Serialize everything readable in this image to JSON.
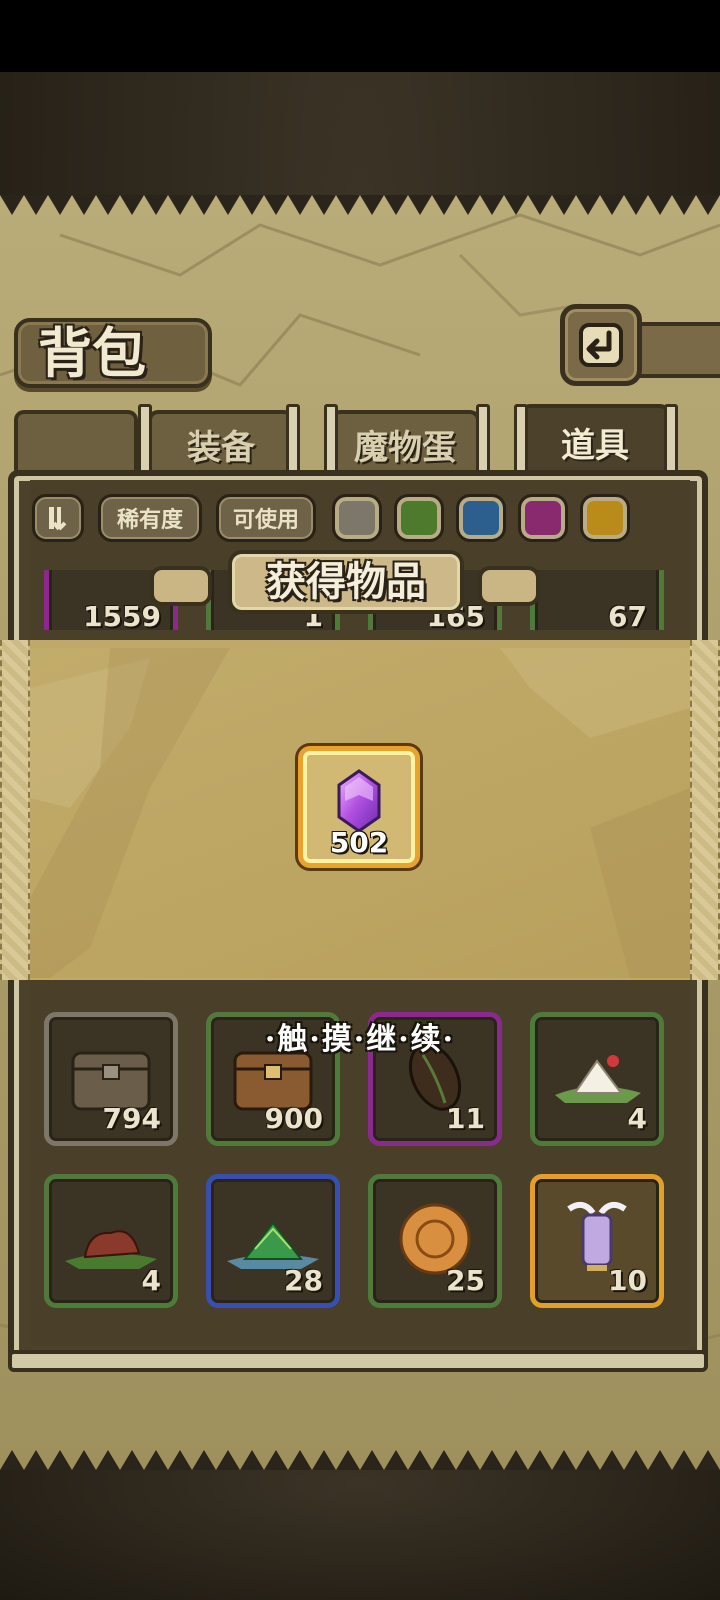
{
  "header": {
    "title": "背包",
    "back_icon": "back-arrow-icon"
  },
  "tabs": [
    {
      "label": "装备",
      "active": false
    },
    {
      "label": "魔物蛋",
      "active": false
    },
    {
      "label": "道具",
      "active": true
    }
  ],
  "filters": {
    "sort_icon": "sort-toggle-icon",
    "rarity_label": "稀有度",
    "usable_label": "可使用",
    "color_swatches": [
      "#7d776a",
      "#4d7a2c",
      "#2c5f8e",
      "#8a2a6e",
      "#b98c1a"
    ]
  },
  "peek_row_counts": [
    "1559",
    "1",
    "165",
    "67"
  ],
  "reward_dialog": {
    "title": "获得物品",
    "item": {
      "name": "purple-gem-icon",
      "count": "502"
    },
    "continue_hint": "·触·摸·继·续·"
  },
  "inventory": [
    {
      "icon": "gray-chest-icon",
      "count": "794",
      "rarity_color": "#7d776a"
    },
    {
      "icon": "wooden-chest-icon",
      "count": "900",
      "rarity_color": "#4f7a3c"
    },
    {
      "icon": "seed-icon",
      "count": "11",
      "rarity_color": "#8a2a8e"
    },
    {
      "icon": "rice-dumpling-icon",
      "count": "4",
      "rarity_color": "#4f7a3c"
    },
    {
      "icon": "red-meat-dumpling-icon",
      "count": "4",
      "rarity_color": "#4f7a3c"
    },
    {
      "icon": "green-dumpling-icon",
      "count": "28",
      "rarity_color": "#3550b0"
    },
    {
      "icon": "mooncake-icon",
      "count": "25",
      "rarity_color": "#4f7a3c"
    },
    {
      "icon": "winged-lantern-icon",
      "count": "10",
      "rarity_color": "#e2a02a"
    }
  ]
}
